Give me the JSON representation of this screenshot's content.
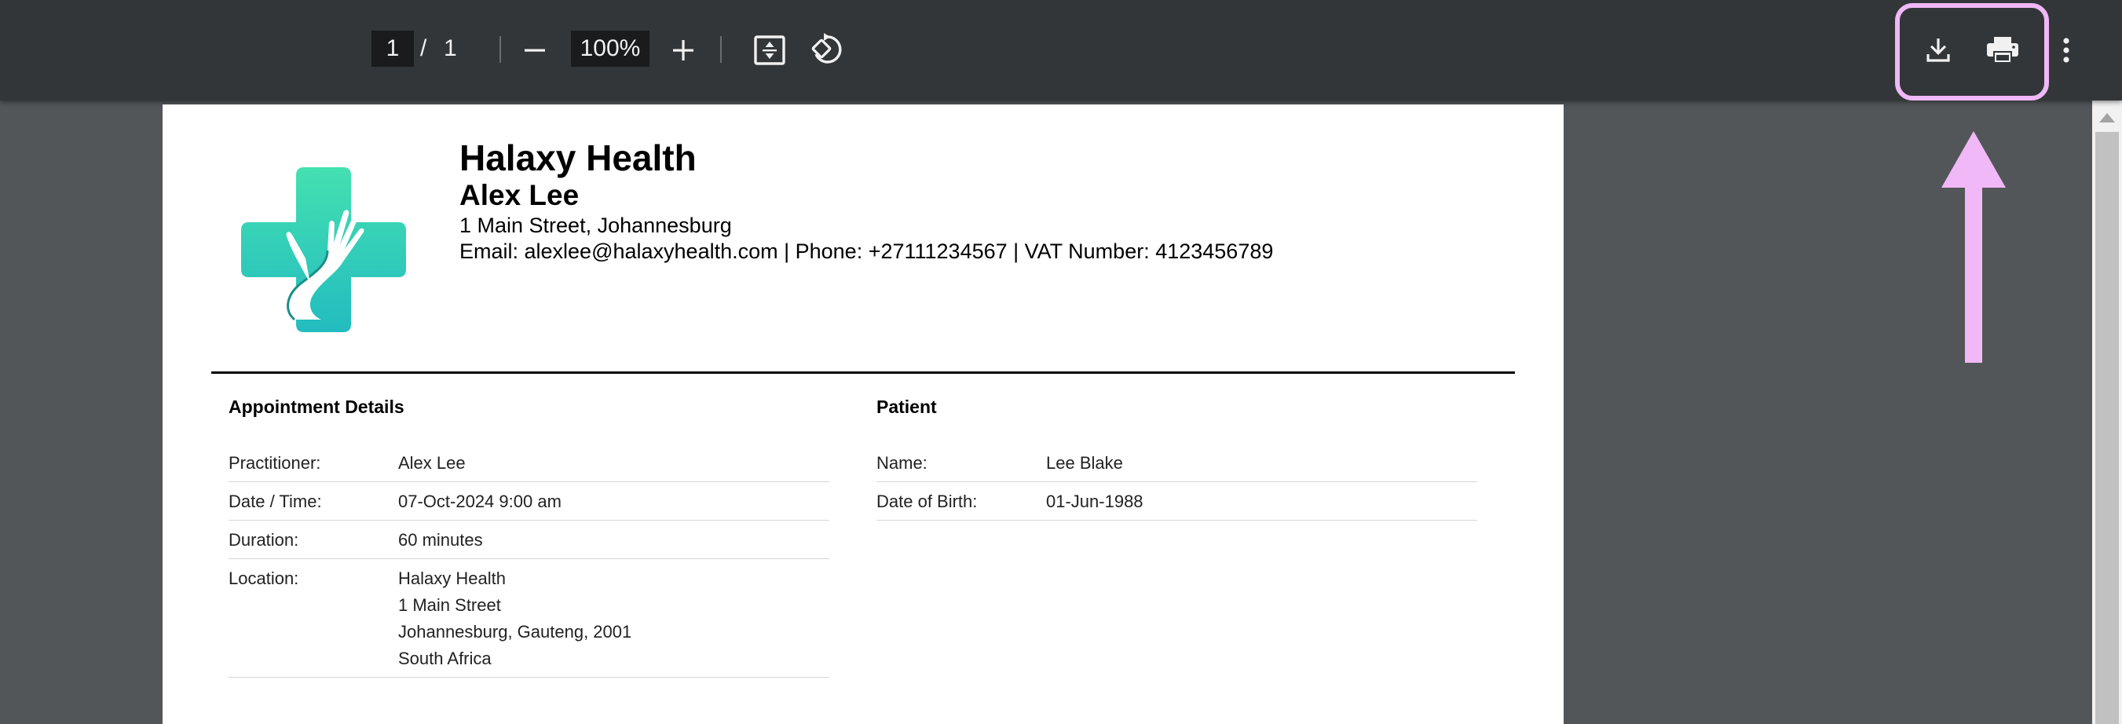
{
  "toolbar": {
    "page_current": "1",
    "page_separator": "/",
    "page_total": "1",
    "zoom": "100%",
    "icons": [
      "zoom-out-icon",
      "zoom-in-icon",
      "fit-page-icon",
      "rotate-icon",
      "download-icon",
      "print-icon",
      "more-vert-icon"
    ]
  },
  "annotation": {
    "color": "#f0b8f7"
  },
  "document": {
    "org_name": "Halaxy Health",
    "practitioner": "Alex Lee",
    "address": "1 Main Street, Johannesburg",
    "contact": "Email: alexlee@halaxyhealth.com | Phone: +27111234567 | VAT Number: 4123456789",
    "appointment": {
      "title": "Appointment Details",
      "rows": [
        {
          "label": "Practitioner:",
          "value": "Alex Lee"
        },
        {
          "label": "Date / Time:",
          "value": "07-Oct-2024 9:00 am"
        },
        {
          "label": "Duration:",
          "value": "60 minutes"
        }
      ],
      "location_label": "Location:",
      "location_lines": [
        "Halaxy Health",
        "1 Main Street",
        "Johannesburg, Gauteng, 2001",
        "South Africa"
      ]
    },
    "patient": {
      "title": "Patient",
      "rows": [
        {
          "label": "Name:",
          "value": "Lee Blake"
        },
        {
          "label": "Date of Birth:",
          "value": "01-Jun-1988"
        }
      ]
    }
  },
  "colors": {
    "toolbar_bg": "#323639",
    "viewer_bg": "#525659",
    "logo_top": "#44e0b0",
    "logo_bottom": "#22bcc0"
  }
}
